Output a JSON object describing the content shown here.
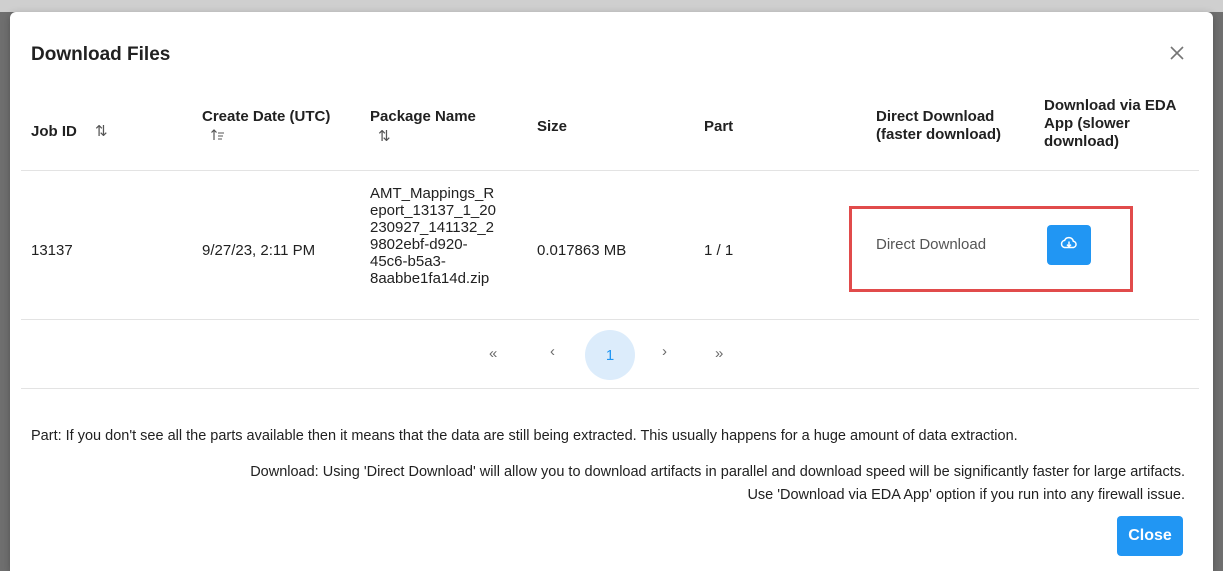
{
  "dialog": {
    "title": "Download Files",
    "close_icon": "close-icon"
  },
  "table": {
    "columns": {
      "job_id": "Job ID",
      "create_date": "Create Date (UTC)",
      "package_name": "Package Name",
      "size": "Size",
      "part": "Part",
      "direct_download": [
        "Direct Download",
        "(faster download)"
      ],
      "eda_download": [
        "Download via EDA",
        "App (slower",
        "download)"
      ]
    },
    "sort_icons": {
      "job_id": "sort-icon",
      "create_date": "sort-ascending-icon",
      "package_name": "sort-icon"
    },
    "rows": [
      {
        "job_id": "13137",
        "create_date": "9/27/23, 2:11 PM",
        "package_name_lines": [
          "AMT_Mappings_R",
          "eport_13137_1_20",
          "230927_141132_2",
          "9802ebf-d920-",
          "45c6-b5a3-",
          "8aabbe1fa14d.zip"
        ],
        "size": "0.017863 MB",
        "part": "1 / 1",
        "direct_download": "Direct Download",
        "eda_icon": "cloud-download-icon"
      }
    ]
  },
  "pagination": {
    "first": "«",
    "prev": "‹",
    "current": "1",
    "next": "›",
    "last": "»"
  },
  "notes": {
    "part": "Part: If you don't see all the parts available then it means that the data are still being extracted. This usually happens for a huge amount of data extraction.",
    "download_line1": "Download: Using 'Direct Download' will allow you to download artifacts in parallel and download speed will be significantly faster for large artifacts.",
    "download_line2": "Use 'Download via EDA App' option if you run into any firewall issue."
  },
  "footer": {
    "close_label": "Close"
  },
  "colors": {
    "accent": "#2196f3",
    "highlight": "#e14b4b",
    "pager_active_bg": "#dcecfb"
  }
}
